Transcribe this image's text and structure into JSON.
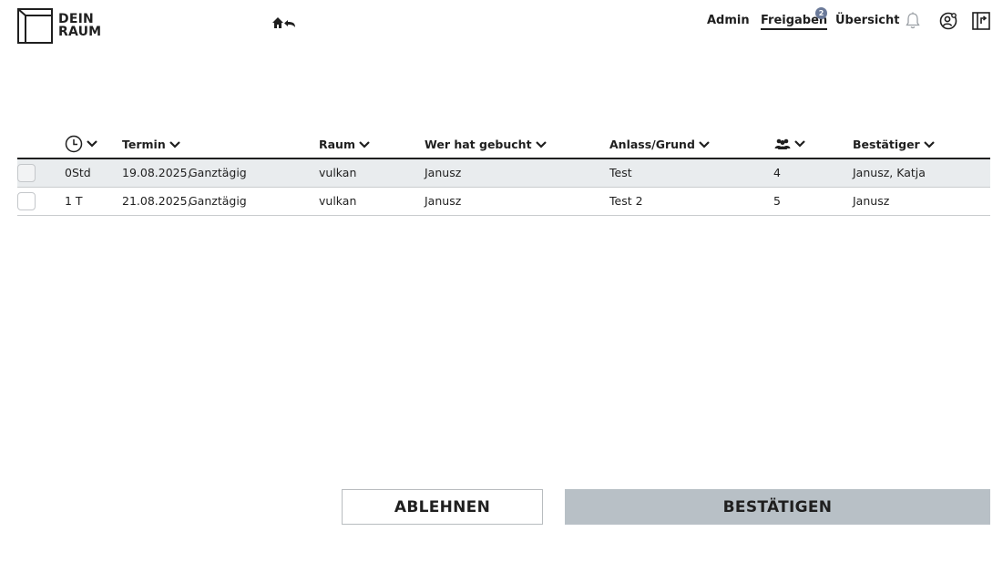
{
  "brand": {
    "line1": "DEIN",
    "line2": "RAUM"
  },
  "nav": {
    "admin": "Admin",
    "approvals": "Freigaben",
    "approvals_badge": "2",
    "overview": "Übersicht"
  },
  "table": {
    "headers": {
      "termin": "Termin",
      "raum": "Raum",
      "wer": "Wer hat gebucht",
      "anlass": "Anlass/Grund",
      "bestaetiger": "Bestätiger"
    },
    "rows": [
      {
        "duration": "0Std",
        "date": "19.08.2025,",
        "time": "Ganztägig",
        "room": "vulkan",
        "booker": "Janusz",
        "reason": "Test",
        "persons": "4",
        "approvers": "Janusz, Katja"
      },
      {
        "duration": "1 T",
        "date": "21.08.2025,",
        "time": "Ganztägig",
        "room": "vulkan",
        "booker": "Janusz",
        "reason": "Test 2",
        "persons": "5",
        "approvers": "Janusz"
      }
    ]
  },
  "actions": {
    "reject": "ABLEHNEN",
    "confirm": "BESTÄTIGEN"
  },
  "colors": {
    "badge": "#6b7a99",
    "confirm_bg": "#b8c0c6",
    "selected_row": "#e9ecee"
  }
}
